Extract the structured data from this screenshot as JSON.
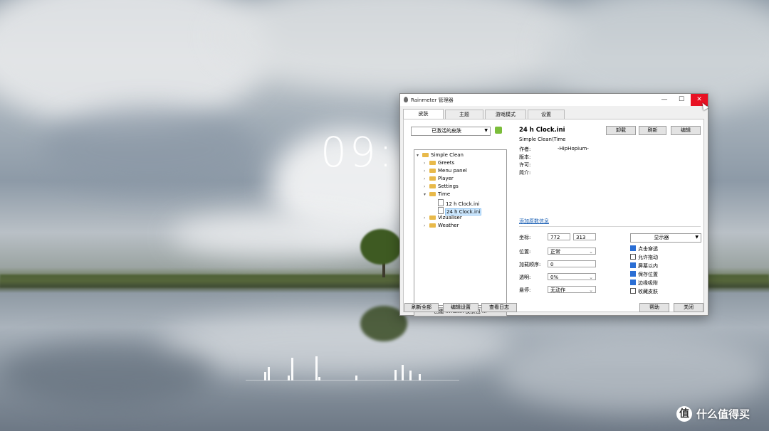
{
  "desktop": {
    "clock": "09:5",
    "visualizer_levels": [
      0.35,
      0.55,
      0.2,
      0.95,
      1.0,
      0.15,
      0.2,
      0.45,
      0.65,
      0.4,
      0.25
    ]
  },
  "window": {
    "title": "Rainmeter 管理器",
    "controls": {
      "minimize": "—",
      "maximize": "☐",
      "close": "✕"
    },
    "tabs": [
      "皮肤",
      "主题",
      "游戏模式",
      "设置"
    ],
    "active_tab": "皮肤",
    "skins_dropdown": "已激活的皮肤",
    "tree": {
      "root": "Simple Clean",
      "items": [
        "Greets",
        "Menu panel",
        "Player",
        "Settings",
        "Time",
        "12 h Clock.ini",
        "24 h Clock.ini",
        "Vizualiser",
        "Weather"
      ],
      "selected": "24 h Clock.ini"
    },
    "create_package_button": "创建 .rmskin 皮肤包 ...",
    "info": {
      "title": "24 h Clock.ini",
      "path": "Simple Clean\\Time",
      "author_label": "作者:",
      "author_value": "-HipHopium-",
      "version_label": "版本:",
      "license_label": "许可:",
      "description_label": "简介:",
      "add_metadata_link": "添加原数信息"
    },
    "action_buttons": {
      "unload": "卸载",
      "refresh": "刷新",
      "edit": "编辑"
    },
    "settings": {
      "coords_label": "坐标:",
      "coord_x": "772",
      "coord_y": "313",
      "monitor_dropdown": "显示器",
      "position_label": "位置:",
      "position_value": "正常",
      "load_order_label": "加载顺序:",
      "load_order_value": "0",
      "transparency_label": "透明:",
      "transparency_value": "0%",
      "hover_label": "悬停:",
      "hover_value": "无动作",
      "checkboxes": [
        {
          "label": "点击穿透",
          "checked": true
        },
        {
          "label": "允许拖动",
          "checked": false
        },
        {
          "label": "屏幕以内",
          "checked": true
        },
        {
          "label": "保存位置",
          "checked": true
        },
        {
          "label": "边缘吸附",
          "checked": true
        },
        {
          "label": "收藏皮肤",
          "checked": false
        }
      ]
    },
    "bottom_buttons": {
      "refresh_all": "刷新全部",
      "edit_settings": "编辑设置",
      "view_log": "查看日志",
      "help": "帮助",
      "close": "关闭"
    }
  },
  "watermark": {
    "logo": "值",
    "text": "什么值得买"
  }
}
